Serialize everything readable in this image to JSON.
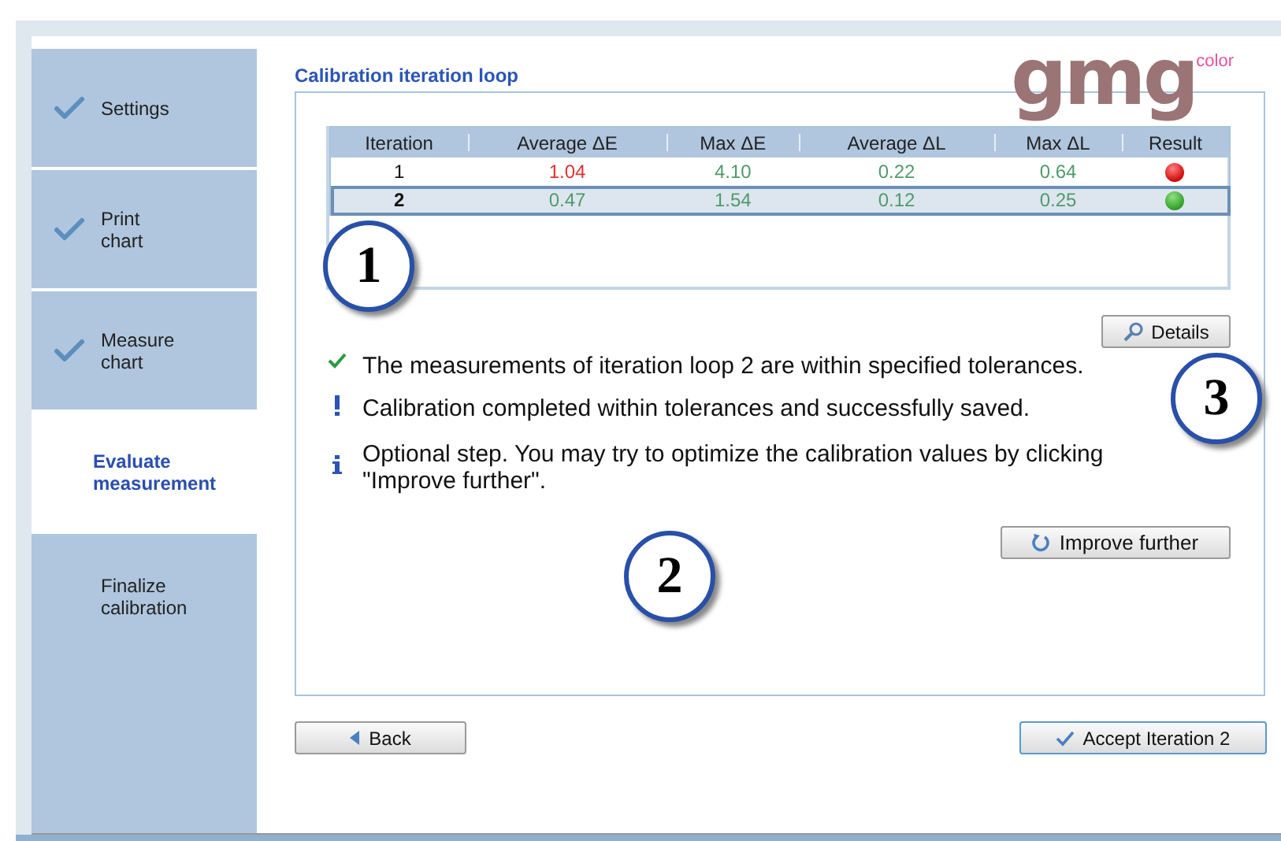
{
  "steps": [
    {
      "label": "Settings",
      "done": true,
      "selected": false
    },
    {
      "label": "Print\nchart",
      "done": true,
      "selected": false
    },
    {
      "label": "Measure\nchart",
      "done": true,
      "selected": false
    },
    {
      "label": "Evaluate\nmeasurement",
      "done": false,
      "selected": true
    },
    {
      "label": "Finalize\ncalibration",
      "done": false,
      "selected": false
    }
  ],
  "logo": {
    "text": "gmg",
    "superscript": "color"
  },
  "section_title": "Calibration iteration loop",
  "table": {
    "columns": [
      "Iteration",
      "Average ΔE",
      "Max ΔE",
      "Average ΔL",
      "Max ΔL",
      "Result"
    ],
    "rows": [
      {
        "selected": false,
        "cells": [
          {
            "text": "1"
          },
          {
            "text": "1.04",
            "ok": false
          },
          {
            "text": "4.10",
            "ok": true
          },
          {
            "text": "0.22",
            "ok": true
          },
          {
            "text": "0.64",
            "ok": true
          }
        ],
        "passed": false
      },
      {
        "selected": true,
        "cells": [
          {
            "text": "2"
          },
          {
            "text": "0.47",
            "ok": true
          },
          {
            "text": "1.54",
            "ok": true
          },
          {
            "text": "0.12",
            "ok": true
          },
          {
            "text": "0.25",
            "ok": true
          }
        ],
        "passed": true
      }
    ]
  },
  "details_button": "Details",
  "messages": [
    {
      "kind": "check",
      "text": "The measurements of iteration loop 2 are within specified tolerances."
    },
    {
      "kind": "warning",
      "text": "Calibration completed within tolerances and successfully saved."
    },
    {
      "kind": "info",
      "text": "Optional step. You may try to optimize the calibration values by clicking \"Improve further\"."
    }
  ],
  "improve_button": "Improve further",
  "back_button": "Back",
  "accept_button": "Accept Iteration 2",
  "callouts": [
    "1",
    "2",
    "3"
  ]
}
